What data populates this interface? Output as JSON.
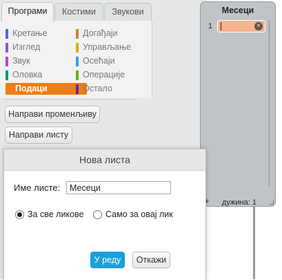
{
  "tabs": [
    {
      "label": "Програми"
    },
    {
      "label": "Костими"
    },
    {
      "label": "Звукови"
    }
  ],
  "categories": {
    "left": [
      {
        "label": "Кретање",
        "color": "#4a6cd4"
      },
      {
        "label": "Изглед",
        "color": "#8a55d7"
      },
      {
        "label": "Звук",
        "color": "#bb42c3"
      },
      {
        "label": "Оловка",
        "color": "#0e9a6c"
      },
      {
        "label": "Подаци",
        "color": "#ee7d16"
      }
    ],
    "right": [
      {
        "label": "Догађаји",
        "color": "#c88330"
      },
      {
        "label": "Управљање",
        "color": "#e1a91a"
      },
      {
        "label": "Осећаји",
        "color": "#2ca5e2"
      },
      {
        "label": "Операције",
        "color": "#5cb712"
      },
      {
        "label": "Остало",
        "color": "#632d99"
      }
    ],
    "selected": "Подаци"
  },
  "buttons": {
    "make_variable": "Направи променљиву",
    "make_list": "Направи листу"
  },
  "dialog": {
    "title": "Нова листа",
    "name_label": "Име листе:",
    "name_value": "Месеци",
    "option_all": "За све ликове",
    "option_this": "Само за овај лик",
    "ok": "У реду",
    "cancel": "Откажи"
  },
  "monitor": {
    "title": "Месеци",
    "index": "1",
    "add": "+",
    "length": "дужина: 1"
  }
}
